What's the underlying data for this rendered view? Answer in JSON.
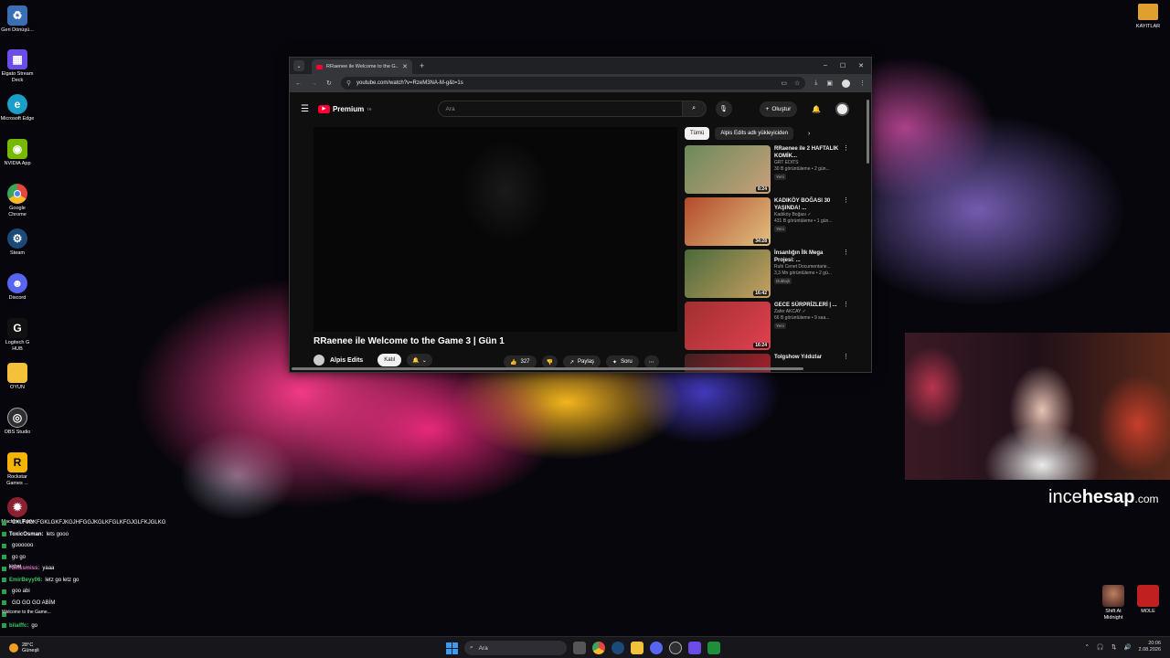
{
  "desktop": {
    "icons": [
      {
        "name": "recycle-bin",
        "label": "Geri Dönüşü...",
        "color": "#3b6fb5"
      },
      {
        "name": "elgato-stream-deck",
        "label": "Elgato Stream Deck",
        "color": "#6b4ce6"
      },
      {
        "name": "microsoft-edge",
        "label": "Microsoft Edge",
        "color": "#1aa0c8"
      },
      {
        "name": "nvidia-app",
        "label": "NVIDIA App",
        "color": "#76b900"
      },
      {
        "name": "google-chrome",
        "label": "Google Chrome",
        "color": "#e8453c"
      },
      {
        "name": "steam",
        "label": "Steam",
        "color": "#1b2838"
      },
      {
        "name": "discord",
        "label": "Discord",
        "color": "#5865f2"
      },
      {
        "name": "logitech-g-hub",
        "label": "Logitech G HUB",
        "color": "#111111"
      },
      {
        "name": "oyun-folder",
        "label": "OYUN",
        "color": "#f3c13a"
      },
      {
        "name": "obs-studio",
        "label": "OBS Studio",
        "color": "#302e31"
      },
      {
        "name": "rockstar-games",
        "label": "Rockstar Games ...",
        "color": "#f4b400"
      },
      {
        "name": "machine",
        "label": "Machine Party",
        "color": "#8a2030"
      }
    ],
    "topright": {
      "label": "KAYITLAR"
    },
    "bottomright": [
      {
        "name": "shift-at-midnight",
        "label": "Shift At Midnight"
      },
      {
        "name": "mole",
        "label": "MOLE"
      }
    ]
  },
  "browser": {
    "tab_title": "RRaenee ile Welcome to the G...",
    "url": "youtube.com/watch?v=RzeM3NA-M-g&t=1s",
    "window_controls": [
      "–",
      "☐",
      "✕"
    ]
  },
  "youtube": {
    "logo": "Premium",
    "logo_sup": "TR",
    "search_placeholder": "Ara",
    "create_label": "Oluştur",
    "video_title": "RRaenee ile Welcome to the Game 3 | Gün 1",
    "channel": "Alpis Edits",
    "subscribe": "Katıl",
    "likes": "327",
    "share": "Paylaş",
    "ask": "Soru",
    "chips": [
      "Tümü",
      "Alpis Edits adlı yükleyiciden"
    ],
    "recommendations": [
      {
        "title": "RRaenee ile 2 HAFTALIK KOMİK...",
        "channel": "GRT EDITS",
        "meta": "30 B görüntüleme • 2 gün...",
        "badge": "Yeni",
        "duration": "8:24",
        "thumb": [
          "#6a8a5a",
          "#c9a07a"
        ]
      },
      {
        "title": "KADIKÖY BOĞASI 30 YAŞINDA! ...",
        "channel": "Kadıköy Boğası ✓",
        "meta": "431 B görüntüleme • 1 gün...",
        "badge": "Yeni",
        "duration": "34:28",
        "thumb": [
          "#b34a2a",
          "#e0c080"
        ]
      },
      {
        "title": "İnsanlığın İlk Mega Projesi: ...",
        "channel": "Ruhi Cenet Documentarie...",
        "meta": "3,3 Mn görüntüleme • 2 gü...",
        "badge": "Dublajlı",
        "duration": "16:42",
        "thumb": [
          "#4a6a3a",
          "#c8a060"
        ]
      },
      {
        "title": "GECE SÜRPRİZLERİ | ...",
        "channel": "Zafer AKCAY ✓",
        "meta": "66 B görüntüleme • 9 saa...",
        "badge": "Yeni",
        "duration": "16:24",
        "thumb": [
          "#a03030",
          "#e04050"
        ]
      },
      {
        "title": "Tolgshow Yıldızlar",
        "channel": "",
        "meta": "",
        "badge": "",
        "duration": "",
        "thumb": [
          "#402020",
          "#c02030"
        ]
      }
    ]
  },
  "overlay": {
    "watermark_pre": "ince",
    "watermark_bold": "hesap",
    "watermark_post": ".com"
  },
  "chat": [
    {
      "user": "",
      "text": "CKLFJGKFGKLGKFJKGJHFGGJKGLKFGLKFGJGLFKJGLKG",
      "color": "#ffffff"
    },
    {
      "user": "ToxicOsman:",
      "text": "lets gooo",
      "color": "#ffffff"
    },
    {
      "user": "",
      "text": "goooooo",
      "color": "#e04040"
    },
    {
      "user": "",
      "text": "go go",
      "color": "#4a7ae0"
    },
    {
      "user": "rukissmiss:",
      "text": "yaaa",
      "color": "#e070c0"
    },
    {
      "user": "EmirBeyy06:",
      "text": "letz go letz go",
      "color": "#40c060"
    },
    {
      "user": "",
      "text": "goo abi",
      "color": "#e04040"
    },
    {
      "user": "",
      "text": "GO GO GO ABİM",
      "color": "#ffffff"
    },
    {
      "user": "",
      "text": "",
      "color": "#ffffff"
    },
    {
      "user": "bilalffc:",
      "text": "go",
      "color": "#40c060"
    }
  ],
  "chat_labels": {
    "kichat": "kichat",
    "welcome": "Welcome to the Game..."
  },
  "taskbar": {
    "weather_temp": "28°C",
    "weather_desc": "Güneşli",
    "search": "Ara",
    "time": "20:06",
    "date": "2.08.2026"
  }
}
